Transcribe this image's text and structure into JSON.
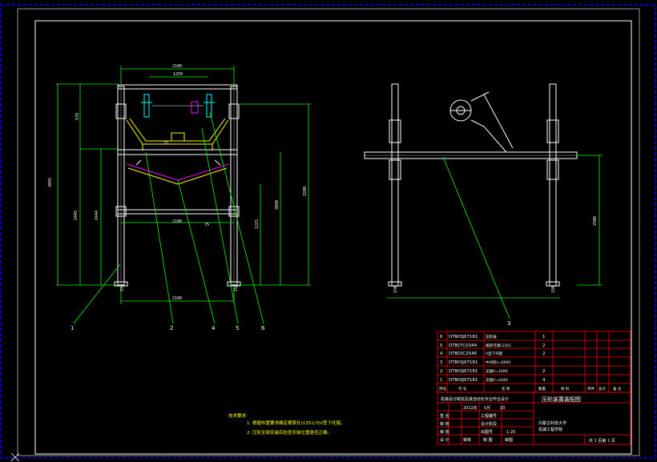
{
  "drawing": {
    "title": "压轮装置装配图",
    "school": "内蒙古科技大学",
    "department": "机械工程学院",
    "project": "机械设计制造及其自动化专业毕业设计",
    "date": {
      "year": "2012年",
      "month": "5月",
      "day": "20"
    },
    "scale": "1:20",
    "sheet": "共 1 页第 1 页"
  },
  "title_block": {
    "rows": [
      {
        "role": "签 名",
        "item": "工程编号"
      },
      {
        "role": "审 核",
        "item": "设计阶段"
      },
      {
        "role": "审 核",
        "item": "出图号"
      },
      {
        "role": "设 计",
        "c1": "审核",
        "c2": "制 图",
        "c3": "审图"
      }
    ],
    "header": [
      "序号",
      "代 号",
      "名 称",
      "数量",
      "材 料",
      "单件",
      "总计",
      "备 注"
    ]
  },
  "bom": [
    {
      "no": "6",
      "code": "DTⅡ03J07181",
      "name": "压轮轴",
      "qty": "1"
    },
    {
      "no": "5",
      "code": "DTⅡ07C0344",
      "name": "横梁可调L1351",
      "qty": "2"
    },
    {
      "no": "4",
      "code": "DTⅡ03C2546",
      "name": "V型下托辊",
      "qty": "2"
    },
    {
      "no": "3",
      "code": "DTⅡ03J07181",
      "name": "中间架L=6000",
      "qty": ""
    },
    {
      "no": "2",
      "code": "DTⅡ03J07181",
      "name": "支腿H=1690",
      "qty": "2"
    },
    {
      "no": "1",
      "code": "DTⅡ03J07181",
      "name": "支腿H=2440",
      "qty": "4"
    }
  ],
  "notes": {
    "heading": "技术要求:",
    "lines": [
      "1. 根据布置要求确定横梁长(1351)与V型下托辊。",
      "2. 压轮全部安装后检查安装位置是否正确。"
    ]
  },
  "dimensions": {
    "front_top": "2100",
    "front_inner": "1250",
    "front_mid": "2100",
    "front_bottom": "2100",
    "h_total": "3095",
    "h_left": "2445",
    "h_left2": "2444",
    "h_right": "3280",
    "h_right2": "3080",
    "h_inner": "1215",
    "upper": "978",
    "d_small": "75",
    "d_small2": "25",
    "foot_left": "150",
    "foot_right": "150",
    "side_height": "2500",
    "side_foot_l": "150",
    "side_foot_r": "150"
  },
  "balloons": [
    "1",
    "2",
    "4",
    "5",
    "6",
    "3"
  ],
  "colors": {
    "frame": "#ffffff",
    "dim": "#00ff00",
    "table": "#ff0000",
    "part": "#ffff00",
    "roller": "#00ffff",
    "inner": "#ff00ff",
    "border": "#0000ff"
  }
}
